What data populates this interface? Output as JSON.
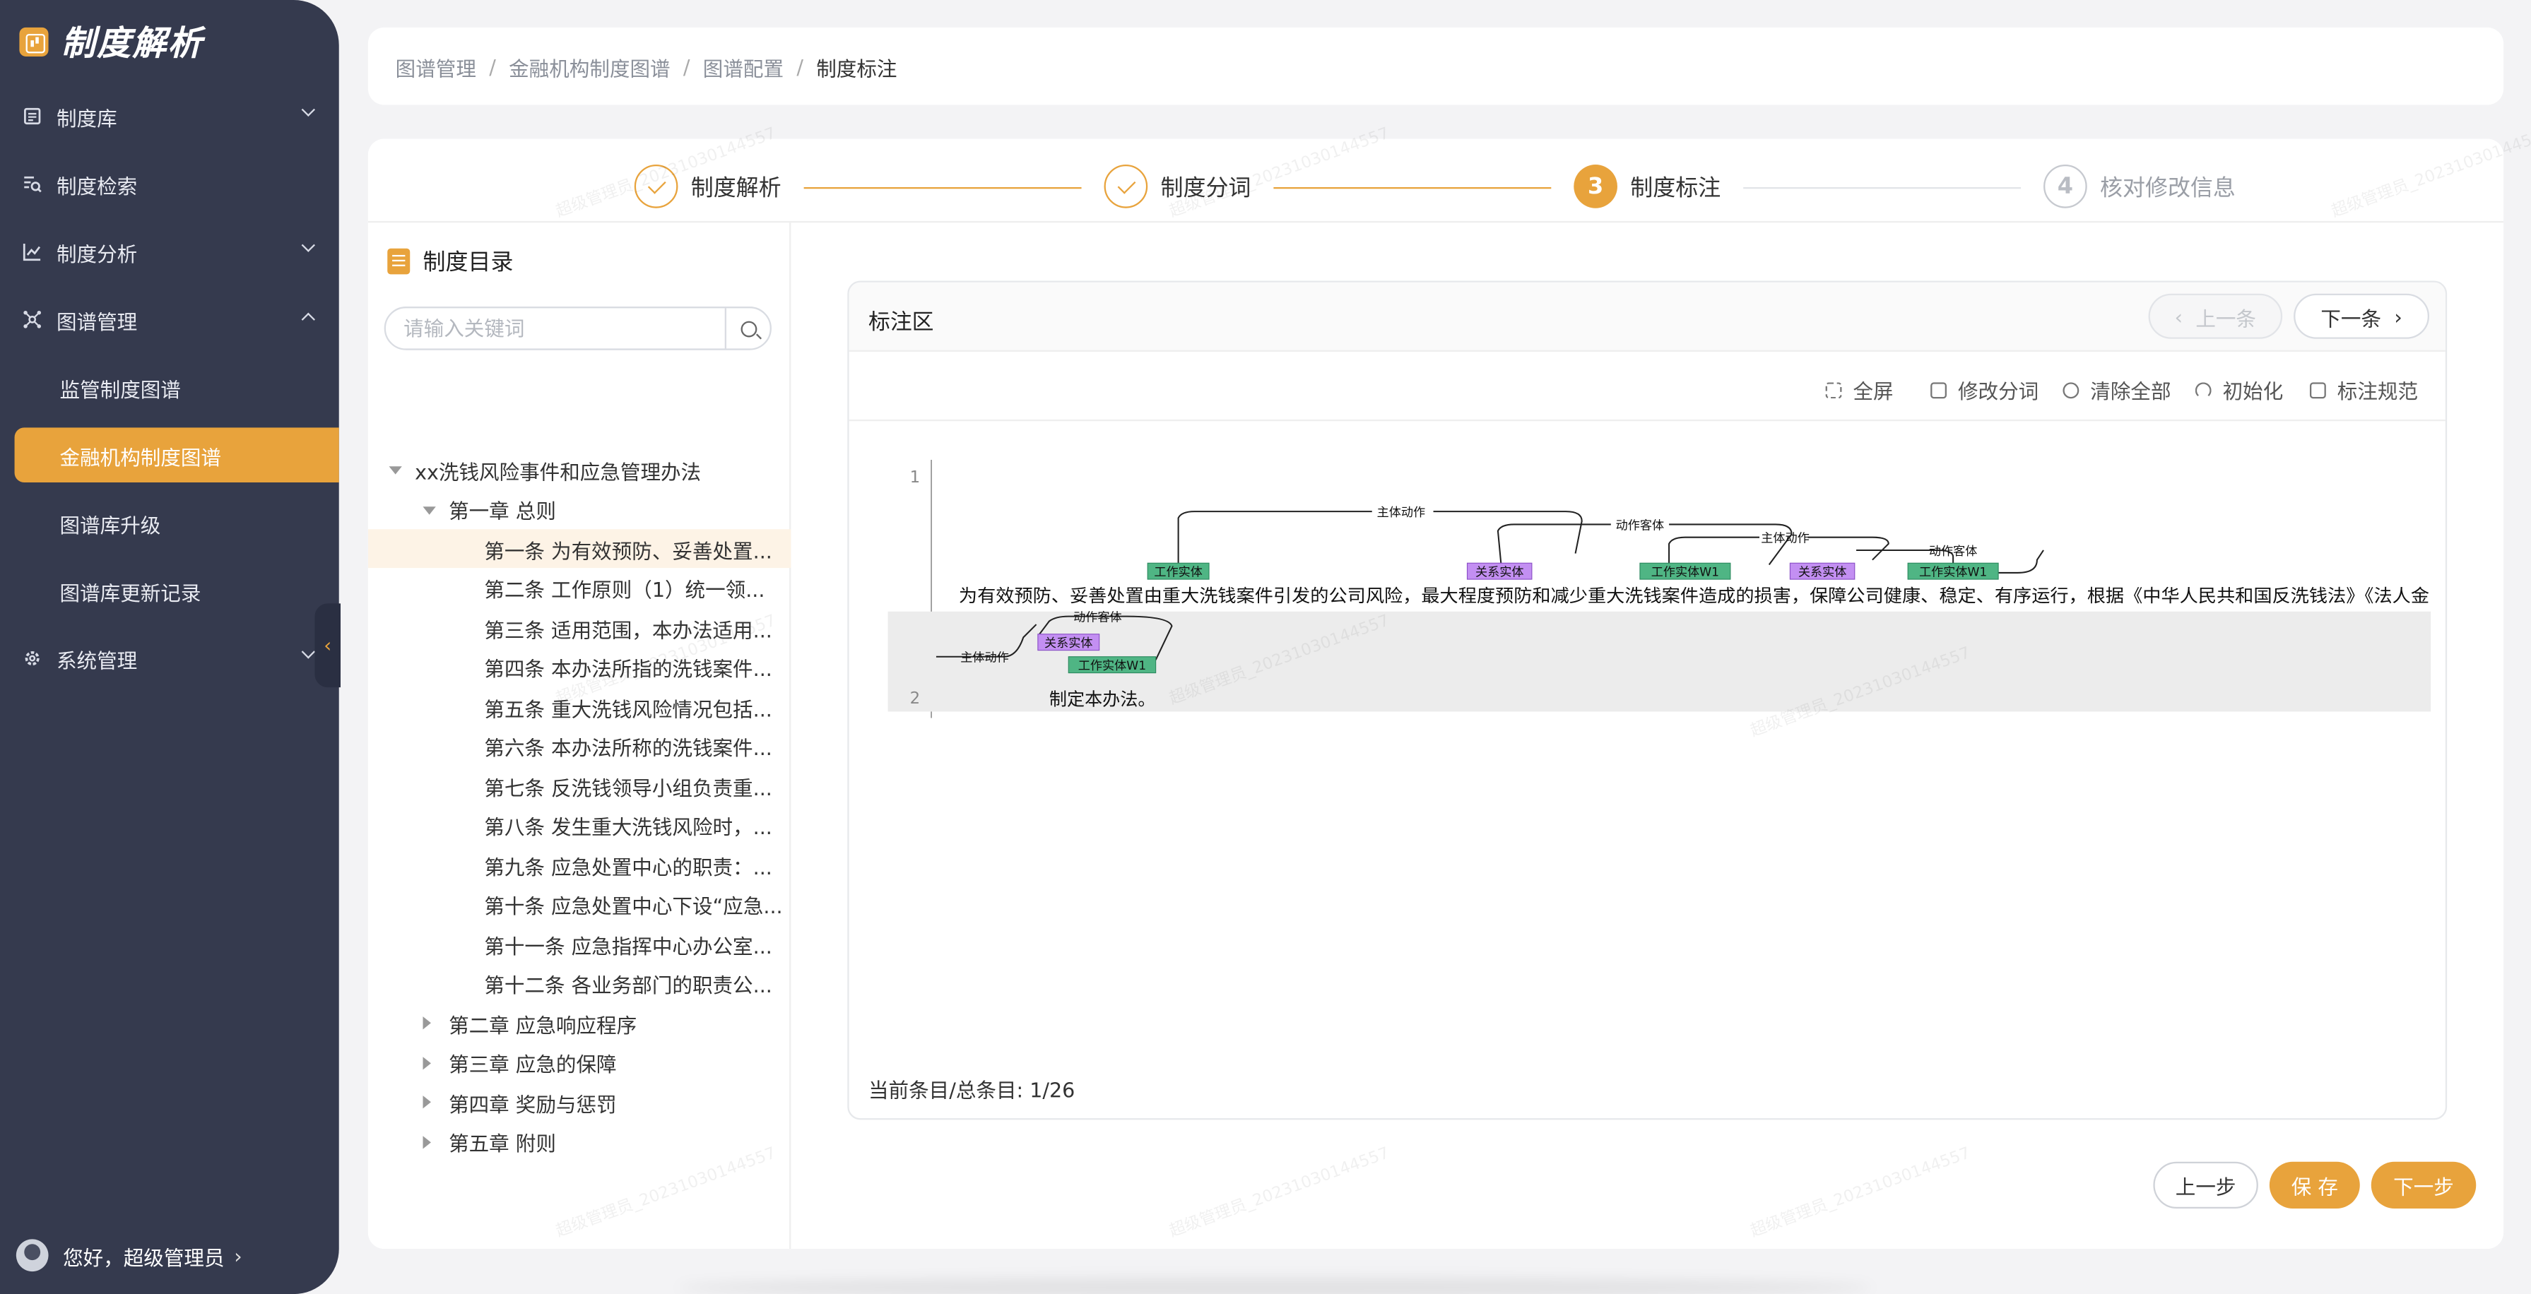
{
  "brand": {
    "title": "制度解析"
  },
  "sidebar": {
    "items": [
      {
        "label": "制度库",
        "icon": "book-icon"
      },
      {
        "label": "制度检索",
        "icon": "search-list-icon"
      },
      {
        "label": "制度分析",
        "icon": "line-chart-icon"
      },
      {
        "label": "图谱管理",
        "icon": "graph-icon"
      },
      {
        "label": "系统管理",
        "icon": "gear-icon"
      }
    ],
    "sub_items": [
      {
        "label": "监管制度图谱"
      },
      {
        "label": "金融机构制度图谱"
      },
      {
        "label": "图谱库升级"
      },
      {
        "label": "图谱库更新记录"
      }
    ],
    "user": "您好，超级管理员"
  },
  "breadcrumb": [
    "图谱管理",
    "金融机构制度图谱",
    "图谱配置",
    "制度标注"
  ],
  "steps": [
    {
      "num": "1",
      "label": "制度解析",
      "state": "done"
    },
    {
      "num": "2",
      "label": "制度分词",
      "state": "done"
    },
    {
      "num": "3",
      "label": "制度标注",
      "state": "active"
    },
    {
      "num": "4",
      "label": "核对修改信息",
      "state": "pending"
    }
  ],
  "tree": {
    "title": "制度目录",
    "search_placeholder": "请输入关键词",
    "nodes": [
      {
        "label": "xx洗钱风险事件和应急管理办法",
        "level": 0,
        "expanded": true
      },
      {
        "label": "第一章 总则",
        "level": 1,
        "expanded": true
      },
      {
        "label": "第一条 为有效预防、妥善处置...",
        "level": 2,
        "selected": true
      },
      {
        "label": "第二条 工作原则（1）统一领...",
        "level": 2
      },
      {
        "label": "第三条 适用范围，本办法适用...",
        "level": 2
      },
      {
        "label": "第四条 本办法所指的洗钱案件...",
        "level": 2
      },
      {
        "label": "第五条 重大洗钱风险情况包括...",
        "level": 2
      },
      {
        "label": "第六条 本办法所称的洗钱案件...",
        "level": 2
      },
      {
        "label": "第七条 反洗钱领导小组负责重...",
        "level": 2
      },
      {
        "label": "第八条 发生重大洗钱风险时，...",
        "level": 2
      },
      {
        "label": "第九条 应急处置中心的职责：...",
        "level": 2
      },
      {
        "label": "第十条 应急处置中心下设“应急...",
        "level": 2
      },
      {
        "label": "第十一条 应急指挥中心办公室...",
        "level": 2
      },
      {
        "label": "第十二条 各业务部门的职责公...",
        "level": 2
      },
      {
        "label": "第二章 应急响应程序",
        "level": 1,
        "expanded": false
      },
      {
        "label": "第三章 应急的保障",
        "level": 1,
        "expanded": false
      },
      {
        "label": "第四章 奖励与惩罚",
        "level": 1,
        "expanded": false
      },
      {
        "label": "第五章 附则",
        "level": 1,
        "expanded": false
      }
    ]
  },
  "annotation": {
    "title": "标注区",
    "prev": "上一条",
    "next": "下一条",
    "tools": [
      "全屏",
      "修改分词",
      "清除全部",
      "初始化",
      "标注规范"
    ],
    "line1_no": "1",
    "line2_no": "2",
    "line1_text": "为有效预防、妥善处置由重大洗钱案件引发的公司风险，最大程度预防和减少重大洗钱案件造成的损害，保障公司健康、稳定、有序运行，根据《中华人民共和国反洗钱法》《法人金",
    "line2_text": "制定本办法。",
    "tags": [
      "工作实体",
      "关系实体",
      "工作实体W1",
      "关系实体",
      "工作实体W1",
      "关系实体",
      "工作实体W1"
    ],
    "relations": [
      "主体动作",
      "动作客体",
      "主体动作",
      "动作客体",
      "主体动作",
      "动作客体"
    ],
    "progress_label": "当前条目/总条目: 1/26",
    "tag_colors": {
      "work": "#4fb584",
      "relation": "#c38ff2"
    }
  },
  "footer": {
    "prev_step": "上一步",
    "save": "保 存",
    "next_step": "下一步"
  },
  "watermark": "超级管理员_20231030144557",
  "colors": {
    "accent": "#e8a33c",
    "sidebar": "#353a4e"
  }
}
